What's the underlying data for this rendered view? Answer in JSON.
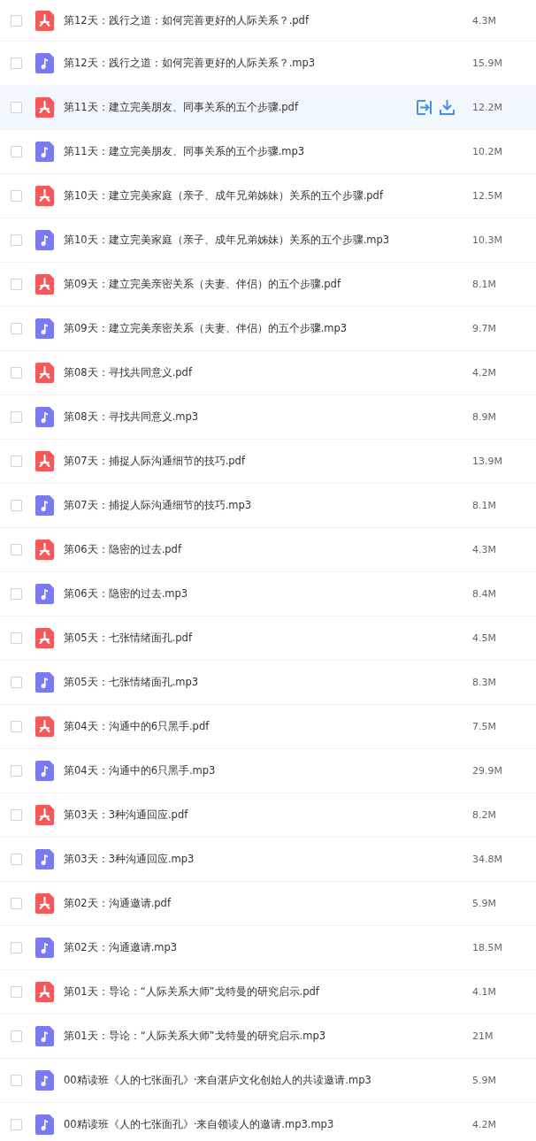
{
  "files": [
    {
      "kind": "pdf",
      "name": "第12天：践行之道：如何完善更好的人际关系？.pdf",
      "size": "4.3M",
      "checked": false,
      "hovered": false
    },
    {
      "kind": "audio",
      "name": "第12天：践行之道：如何完善更好的人际关系？.mp3",
      "size": "15.9M",
      "checked": false,
      "hovered": false
    },
    {
      "kind": "pdf",
      "name": "第11天：建立完美朋友、同事关系的五个步骤.pdf",
      "size": "12.2M",
      "checked": false,
      "hovered": true
    },
    {
      "kind": "audio",
      "name": "第11天：建立完美朋友、同事关系的五个步骤.mp3",
      "size": "10.2M",
      "checked": false,
      "hovered": false
    },
    {
      "kind": "pdf",
      "name": "第10天：建立完美家庭（亲子、成年兄弟姊妹）关系的五个步骤.pdf",
      "size": "12.5M",
      "checked": false,
      "hovered": false
    },
    {
      "kind": "audio",
      "name": "第10天：建立完美家庭（亲子、成年兄弟姊妹）关系的五个步骤.mp3",
      "size": "10.3M",
      "checked": false,
      "hovered": false
    },
    {
      "kind": "pdf",
      "name": "第09天：建立完美亲密关系（夫妻、伴侣）的五个步骤.pdf",
      "size": "8.1M",
      "checked": false,
      "hovered": false
    },
    {
      "kind": "audio",
      "name": "第09天：建立完美亲密关系（夫妻、伴侣）的五个步骤.mp3",
      "size": "9.7M",
      "checked": false,
      "hovered": false
    },
    {
      "kind": "pdf",
      "name": "第08天：寻找共同意义.pdf",
      "size": "4.2M",
      "checked": false,
      "hovered": false
    },
    {
      "kind": "audio",
      "name": "第08天：寻找共同意义.mp3",
      "size": "8.9M",
      "checked": false,
      "hovered": false
    },
    {
      "kind": "pdf",
      "name": "第07天：捕捉人际沟通细节的技巧.pdf",
      "size": "13.9M",
      "checked": false,
      "hovered": false
    },
    {
      "kind": "audio",
      "name": "第07天：捕捉人际沟通细节的技巧.mp3",
      "size": "8.1M",
      "checked": false,
      "hovered": false
    },
    {
      "kind": "pdf",
      "name": "第06天：隐密的过去.pdf",
      "size": "4.3M",
      "checked": false,
      "hovered": false
    },
    {
      "kind": "audio",
      "name": "第06天：隐密的过去.mp3",
      "size": "8.4M",
      "checked": false,
      "hovered": false
    },
    {
      "kind": "pdf",
      "name": "第05天：七张情绪面孔.pdf",
      "size": "4.5M",
      "checked": false,
      "hovered": false
    },
    {
      "kind": "audio",
      "name": "第05天：七张情绪面孔.mp3",
      "size": "8.3M",
      "checked": false,
      "hovered": false
    },
    {
      "kind": "pdf",
      "name": "第04天：沟通中的6只黑手.pdf",
      "size": "7.5M",
      "checked": false,
      "hovered": false
    },
    {
      "kind": "audio",
      "name": "第04天：沟通中的6只黑手.mp3",
      "size": "29.9M",
      "checked": false,
      "hovered": false
    },
    {
      "kind": "pdf",
      "name": "第03天：3种沟通回应.pdf",
      "size": "8.2M",
      "checked": false,
      "hovered": false
    },
    {
      "kind": "audio",
      "name": "第03天：3种沟通回应.mp3",
      "size": "34.8M",
      "checked": false,
      "hovered": false
    },
    {
      "kind": "pdf",
      "name": "第02天：沟通邀请.pdf",
      "size": "5.9M",
      "checked": false,
      "hovered": false
    },
    {
      "kind": "audio",
      "name": "第02天：沟通邀请.mp3",
      "size": "18.5M",
      "checked": false,
      "hovered": false
    },
    {
      "kind": "pdf",
      "name": "第01天：导论：“人际关系大师”戈特曼的研究启示.pdf",
      "size": "4.1M",
      "checked": false,
      "hovered": false
    },
    {
      "kind": "audio",
      "name": "第01天：导论：“人际关系大师”戈特曼的研究启示.mp3",
      "size": "21M",
      "checked": false,
      "hovered": false
    },
    {
      "kind": "audio",
      "name": "00精读班《人的七张面孔》·来自湛庐文化创始人的共读邀请.mp3",
      "size": "5.9M",
      "checked": false,
      "hovered": false
    },
    {
      "kind": "audio",
      "name": "00精读班《人的七张面孔》·来自领读人的邀请.mp3.mp3",
      "size": "4.2M",
      "checked": false,
      "hovered": false
    }
  ]
}
